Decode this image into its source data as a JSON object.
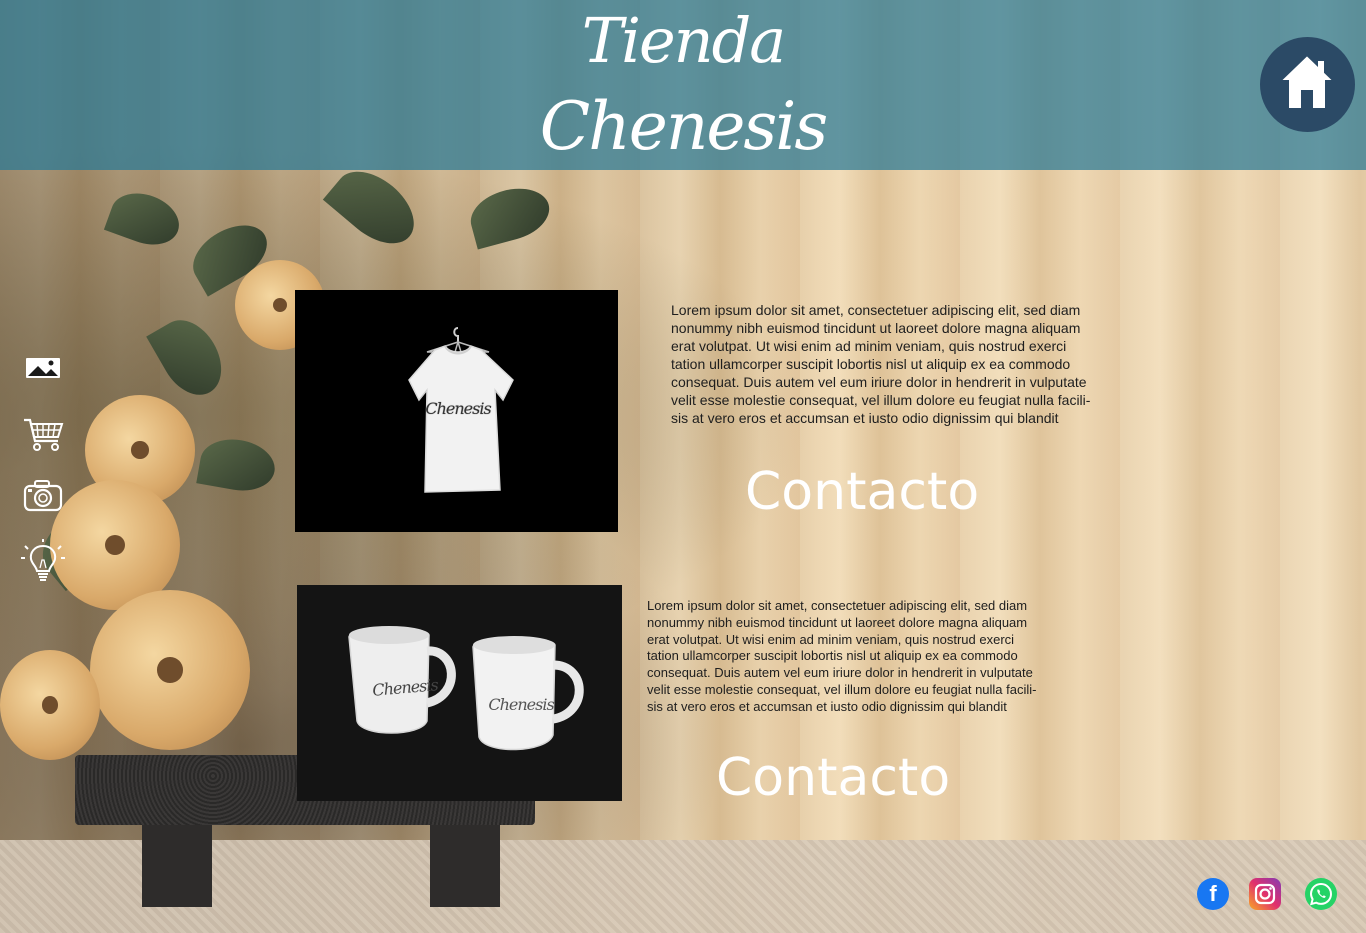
{
  "header": {
    "title_line1": "Tienda",
    "title_line2": "Chenesis",
    "home_icon": "home-icon",
    "background_color": "#2878a0"
  },
  "side_nav": {
    "items": [
      {
        "icon": "image-icon"
      },
      {
        "icon": "cart-icon"
      },
      {
        "icon": "camera-icon"
      },
      {
        "icon": "lightbulb-icon"
      }
    ]
  },
  "products": [
    {
      "image_brand_text": "Chenesis",
      "description": "Lorem ipsum dolor sit amet, consectetuer adipiscing elit, sed diam\nnonummy nibh euismod tincidunt ut laoreet dolore magna aliquam\nerat volutpat. Ut wisi enim ad minim veniam, quis nostrud exerci\ntation ullamcorper suscipit lobortis nisl ut aliquip ex ea commodo\nconsequat. Duis autem vel eum iriure dolor in hendrerit in vulputate\nvelit esse molestie consequat, vel illum dolore eu feugiat nulla facili-\nsis at vero eros et accumsan et iusto odio dignissim qui blandit",
      "contact_label": "Contacto"
    },
    {
      "image_brand_text": "Chenesis",
      "description": "Lorem ipsum dolor sit amet, consectetuer adipiscing elit, sed diam\nnonummy nibh euismod tincidunt ut laoreet dolore magna aliquam\nerat volutpat. Ut wisi enim ad minim veniam, quis nostrud exerci\ntation ullamcorper suscipit lobortis nisl ut aliquip ex ea commodo\nconsequat. Duis autem vel eum iriure dolor in hendrerit in vulputate\nvelit esse molestie consequat, vel illum dolore eu feugiat nulla facili-\nsis at vero eros et accumsan et iusto odio dignissim qui blandit",
      "contact_label": "Contacto"
    }
  ],
  "social": {
    "facebook_glyph": "f",
    "instagram_icon": "instagram-icon",
    "whatsapp_icon": "whatsapp-icon",
    "facebook_color": "#1877f2",
    "whatsapp_color": "#25d366"
  }
}
